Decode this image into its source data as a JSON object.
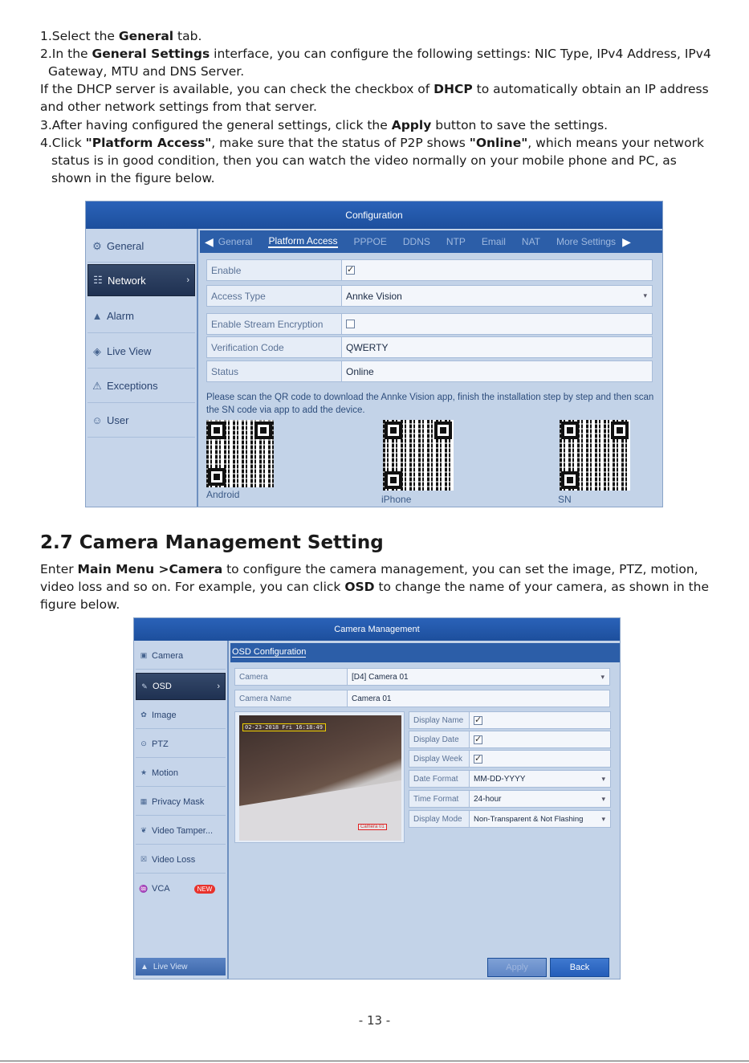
{
  "text": {
    "p1": [
      "1.Select the ",
      "General",
      " tab."
    ],
    "p2a": [
      "2.In the ",
      "General Settings",
      " interface, you can configure the following settings: NIC Type, IPv4 Address, IPv4"
    ],
    "p2b": "Gateway, MTU and DNS Server.",
    "p3a": [
      "If the DHCP server is available, you can check the checkbox of ",
      "DHCP",
      " to automatically obtain an IP address"
    ],
    "p3b": "and other network settings from that server.",
    "p4": [
      "3.After having configured the general settings, click the ",
      "Apply",
      " button to save the settings."
    ],
    "p5a": [
      "4.Click ",
      "\"Platform Access\"",
      ", make sure that the status of P2P shows ",
      "\"Online\"",
      ", which means your network"
    ],
    "p5b": "status is in good condition, then you can watch the video normally on your mobile phone and PC, as",
    "p5c": "shown in the figure below.",
    "heading": "2.7 Camera Management Setting",
    "p6a": [
      "Enter ",
      "Main Menu >Camera",
      " to configure the camera management, you can set the image, PTZ, motion,"
    ],
    "p6b": [
      "video loss and so on. For example, you can click ",
      "OSD",
      " to change the name of your camera, as shown in the"
    ],
    "p6c": "figure below.",
    "page_number": "- 13 -"
  },
  "config_ui": {
    "title": "Configuration",
    "sidebar": [
      {
        "label": "General",
        "icon": "gear-icon",
        "glyph": "⚙"
      },
      {
        "label": "Network",
        "icon": "network-icon",
        "glyph": "☷",
        "active": true
      },
      {
        "label": "Alarm",
        "icon": "alarm-icon",
        "glyph": "▲"
      },
      {
        "label": "Live View",
        "icon": "live-view-icon",
        "glyph": "◈"
      },
      {
        "label": "Exceptions",
        "icon": "warning-icon",
        "glyph": "⚠"
      },
      {
        "label": "User",
        "icon": "user-icon",
        "glyph": "☺"
      }
    ],
    "tabs": [
      "General",
      "Platform Access",
      "PPPOE",
      "DDNS",
      "NTP",
      "Email",
      "NAT",
      "More Settings"
    ],
    "active_tab": "Platform Access",
    "rows": [
      {
        "label": "Enable",
        "type": "checkbox",
        "checked": true
      },
      {
        "label": "Access Type",
        "value": "Annke Vision",
        "type": "dropdown"
      },
      {
        "label": "Enable Stream Encryption",
        "type": "checkbox",
        "checked": false
      },
      {
        "label": "Verification Code",
        "value": "QWERTY",
        "type": "text"
      },
      {
        "label": "Status",
        "value": "Online",
        "type": "text"
      }
    ],
    "notice": "Please scan the QR code to download the Annke Vision app, finish the installation step by step and then scan the SN code via app to add the device.",
    "qr_labels": [
      "Android",
      "iPhone",
      "SN"
    ]
  },
  "camera_ui": {
    "title": "Camera Management",
    "sidebar": [
      {
        "label": "Camera",
        "icon": "camera-icon",
        "glyph": "▣"
      },
      {
        "label": "OSD",
        "icon": "osd-icon",
        "glyph": "✎",
        "active": true
      },
      {
        "label": "Image",
        "icon": "image-icon",
        "glyph": "✿"
      },
      {
        "label": "PTZ",
        "icon": "ptz-icon",
        "glyph": "⊙"
      },
      {
        "label": "Motion",
        "icon": "motion-icon",
        "glyph": "★"
      },
      {
        "label": "Privacy Mask",
        "icon": "privacy-mask-icon",
        "glyph": "▦"
      },
      {
        "label": "Video Tamper...",
        "icon": "video-tamper-icon",
        "glyph": "❦"
      },
      {
        "label": "Video Loss",
        "icon": "video-loss-icon",
        "glyph": "☒"
      },
      {
        "label": "VCA",
        "icon": "vca-icon",
        "glyph": "♒",
        "badge": "NEW"
      }
    ],
    "tab": "OSD Configuration",
    "camera_label": "Camera",
    "camera_value": "[D4] Camera 01",
    "name_label": "Camera Name",
    "name_value": "Camera 01",
    "preview_timestamp": "02-23-2018 Fri 16:18:49",
    "preview_name": "Camera 01",
    "options": [
      {
        "label": "Display Name",
        "type": "checkbox",
        "checked": true
      },
      {
        "label": "Display Date",
        "type": "checkbox",
        "checked": true
      },
      {
        "label": "Display Week",
        "type": "checkbox",
        "checked": true
      },
      {
        "label": "Date Format",
        "value": "MM-DD-YYYY",
        "type": "dropdown"
      },
      {
        "label": "Time Format",
        "value": "24-hour",
        "type": "dropdown"
      },
      {
        "label": "Display Mode",
        "value": "Non-Transparent & Not Flashing",
        "type": "dropdown"
      }
    ],
    "live_view": "Live View",
    "apply": "Apply",
    "back": "Back"
  }
}
